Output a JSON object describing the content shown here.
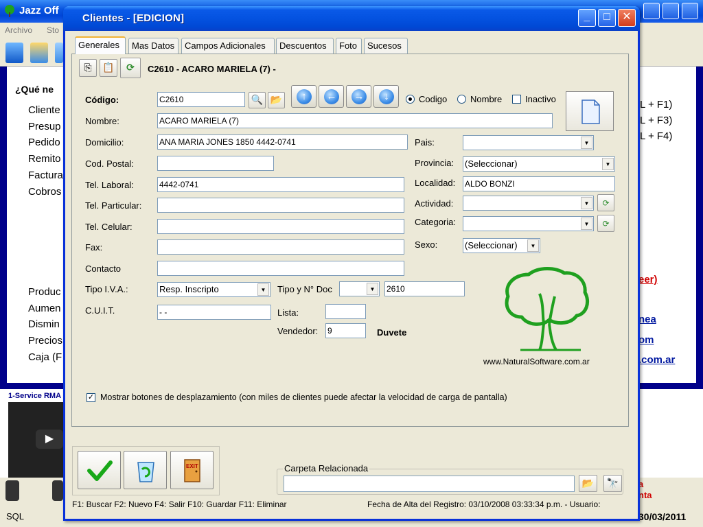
{
  "background": {
    "window_title": "Jazz Off",
    "menu": [
      "Archivo",
      "Sto"
    ],
    "heading": "¿Qué ne",
    "links_top": [
      "Cliente",
      "Presup",
      "Pedido",
      "Remito",
      "Factura",
      "Cobros"
    ],
    "links_bottom": [
      "Produc",
      "Aumen",
      "Dismin",
      "Precios",
      "Caja (F"
    ],
    "shortcuts": [
      "L + F1)",
      "L + F3)",
      "L + F4)"
    ],
    "right_links": [
      "eer)",
      "nea",
      "om",
      ".com.ar"
    ],
    "video_label": "1-Service RMA",
    "video_play": "▶",
    "red_text_1": "a",
    "red_text_2": "nta",
    "sql_label": "SQL",
    "date": "30/03/2011"
  },
  "dialog": {
    "title": "Clientes - [EDICION]",
    "tabs": [
      {
        "label": "Generales",
        "active": true
      },
      {
        "label": "Mas Datos",
        "active": false
      },
      {
        "label": "Campos Adicionales",
        "active": false
      },
      {
        "label": "Descuentos",
        "active": false
      },
      {
        "label": "Foto",
        "active": false
      },
      {
        "label": "Sucesos",
        "active": false
      }
    ],
    "record_title": "C2610 - ACARO MARIELA (7) -",
    "search_mode": {
      "codigo": "Codigo",
      "nombre": "Nombre",
      "inactivo": "Inactivo",
      "selected": "codigo"
    },
    "fields": {
      "codigo": {
        "label": "Código:",
        "value": "C2610"
      },
      "nombre": {
        "label": "Nombre:",
        "value": "ACARO MARIELA (7)"
      },
      "domicilio": {
        "label": "Domicilio:",
        "value": "ANA MARIA JONES 1850    4442-0741"
      },
      "cod_postal": {
        "label": "Cod. Postal:",
        "value": ""
      },
      "tel_laboral": {
        "label": "Tel. Laboral:",
        "value": "4442-0741"
      },
      "tel_particular": {
        "label": "Tel. Particular:",
        "value": ""
      },
      "tel_celular": {
        "label": "Tel. Celular:",
        "value": ""
      },
      "fax": {
        "label": "Fax:",
        "value": ""
      },
      "contacto": {
        "label": "Contacto",
        "value": ""
      },
      "tipo_iva": {
        "label": "Tipo I.V.A.:",
        "value": "Resp. Inscripto"
      },
      "tipo_doc": {
        "label": "Tipo y N° Doc",
        "value": "",
        "numero": "2610"
      },
      "cuit": {
        "label": "C.U.I.T.",
        "value": "-      -"
      },
      "lista": {
        "label": "Lista:",
        "value": ""
      },
      "vendedor": {
        "label": "Vendedor:",
        "value": "9",
        "name": "Duvete"
      },
      "pais": {
        "label": "Pais:",
        "value": ""
      },
      "provincia": {
        "label": "Provincia:",
        "value": "(Seleccionar)"
      },
      "localidad": {
        "label": "Localidad:",
        "value": "ALDO BONZI"
      },
      "actividad": {
        "label": "Actividad:",
        "value": ""
      },
      "categoria": {
        "label": "Categoria:",
        "value": ""
      },
      "sexo": {
        "label": "Sexo:",
        "value": "(Seleccionar)"
      }
    },
    "website": "www.NaturalSoftware.com.ar",
    "show_nav_checkbox": {
      "checked": true,
      "label": "Mostrar botones de desplazamiento  (con miles de clientes puede afectar la velocidad de carga de pantalla)"
    },
    "folder_label": "Carpeta Relacionada",
    "folder_value": "",
    "exit_label": "EXIT",
    "status_shortcuts": "F1: Buscar  F2: Nuevo  F4: Salir  F10: Guardar  F11: Eliminar",
    "status_date": "Fecha de Alta del Registro: 03/10/2008 03:33:34 p.m. - Usuario:",
    "colors": {
      "titlebar": "#0452e0",
      "face": "#ece9d8",
      "tree": "#1fa01f",
      "bg_blue": "#00008a",
      "link_blue": "#0018a0",
      "red": "#d00000"
    }
  }
}
